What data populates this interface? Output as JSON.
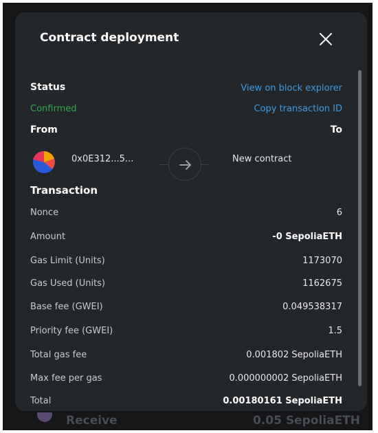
{
  "modal": {
    "title": "Contract deployment"
  },
  "status": {
    "label": "Status",
    "value": "Confirmed",
    "view_explorer": "View on block explorer",
    "copy_tx": "Copy transaction ID"
  },
  "parties": {
    "from_label": "From",
    "to_label": "To",
    "from_address": "0x0E312...5...",
    "to_value": "New contract"
  },
  "transaction": {
    "heading": "Transaction",
    "rows": [
      {
        "label": "Nonce",
        "value": "6"
      },
      {
        "label": "Amount",
        "value": "-0 SepoliaETH"
      },
      {
        "label": "Gas Limit (Units)",
        "value": "1173070"
      },
      {
        "label": "Gas Used (Units)",
        "value": "1162675"
      },
      {
        "label": "Base fee (GWEI)",
        "value": "0.049538317"
      },
      {
        "label": "Priority fee (GWEI)",
        "value": "1.5"
      },
      {
        "label": "Total gas fee",
        "value": "0.001802 SepoliaETH"
      },
      {
        "label": "Max fee per gas",
        "value": "0.000000002 SepoliaETH"
      },
      {
        "label": "Total",
        "value": "0.00180161 SepoliaETH"
      }
    ]
  },
  "background_row": {
    "label": "Receive",
    "value": "0.05 SepoliaETH"
  },
  "colors": {
    "accent_link": "#3b9ae6",
    "status_confirmed": "#2ea94e",
    "modal_bg": "#24272a"
  }
}
